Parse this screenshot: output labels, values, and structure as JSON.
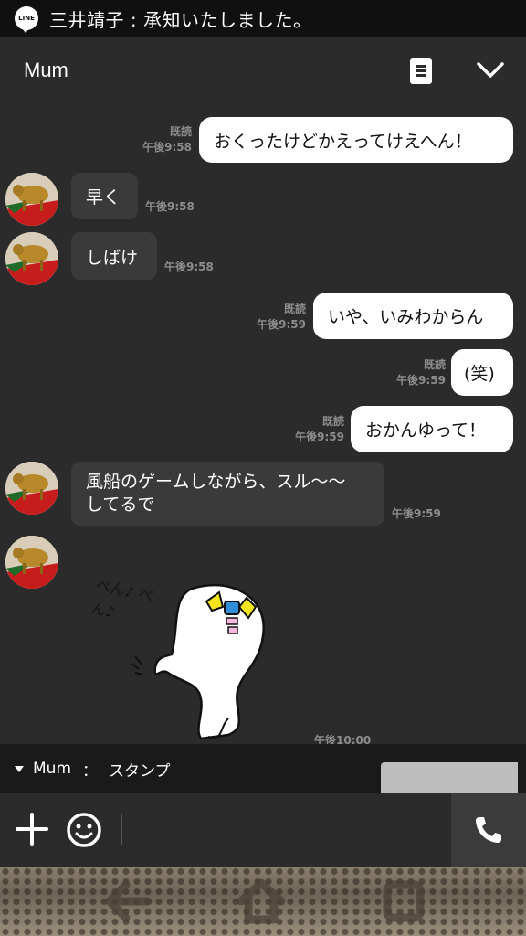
{
  "notification": {
    "app_icon_text": "LINE",
    "text": "三井靖子 : 承知いたしました。"
  },
  "header": {
    "title": "Mum"
  },
  "messages": [
    {
      "dir": "out",
      "read": "既読",
      "time": "午後9:58",
      "text": "おくったけどかえってけえへん！"
    },
    {
      "dir": "in",
      "time": "午後9:58",
      "text": "早く"
    },
    {
      "dir": "in",
      "time": "午後9:58",
      "text": "しばけ"
    },
    {
      "dir": "out",
      "read": "既読",
      "time": "午後9:59",
      "text": "いや、いみわからん"
    },
    {
      "dir": "out",
      "read": "既読",
      "time": "午後9:59",
      "text": "(笑)"
    },
    {
      "dir": "out",
      "read": "既読",
      "time": "午後9:59",
      "text": "おかんゆって！"
    },
    {
      "dir": "in",
      "time": "午後9:59",
      "text_line1": "風船のゲームしながら、スル〜〜",
      "text_line2": "してるで"
    },
    {
      "dir": "in",
      "time": "午後10:00",
      "type": "sticker",
      "sticker_text": "ぺん♪ ぺん♪"
    }
  ],
  "preview": {
    "sender": "Mum",
    "separator": "：",
    "text": "スタンプ"
  },
  "input": {
    "plus_icon": "plus-icon",
    "emoji_icon": "smiley-icon",
    "call_icon": "phone-icon"
  },
  "nav": {
    "back_icon": "back-arrow-icon",
    "home_icon": "home-icon",
    "recents_icon": "recents-icon"
  },
  "colors": {
    "chat_bg": "#2b2b2b",
    "bubble_out": "#ffffff",
    "bubble_in": "#3a3a3a"
  }
}
